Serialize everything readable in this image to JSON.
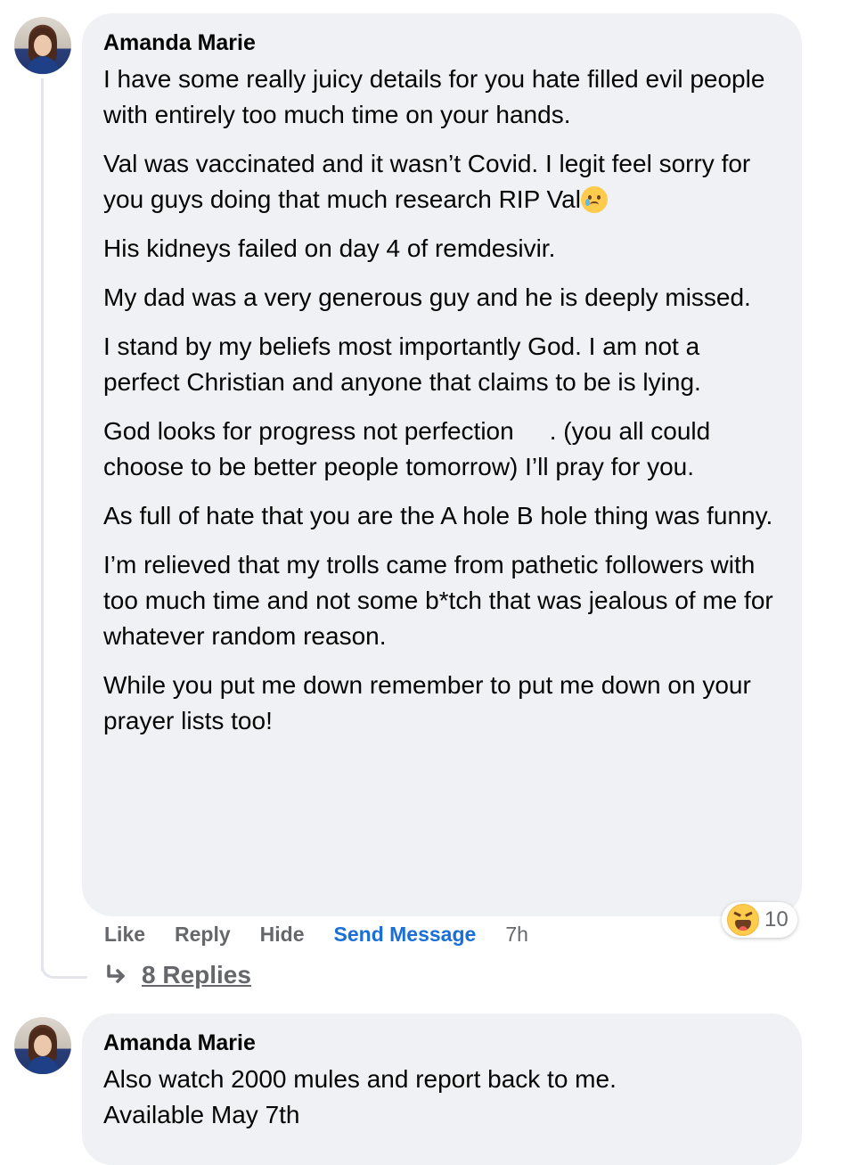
{
  "comments": [
    {
      "author": "Amanda Marie",
      "paragraphs": [
        "I have some really juicy details for you hate filled evil people with entirely too much time on your hands.",
        "Val was vaccinated and it wasn’t Covid. I legit feel sorry for you guys doing that much research RIP Val",
        "His kidneys failed on day 4 of remdesivir.",
        "My dad was a very generous guy and he is deeply missed.",
        "I stand by my beliefs most importantly God. I am not a perfect Christian and anyone that claims to be is lying.",
        "God looks for progress not perfection",
        ". (you all could choose to be better people tomorrow) I’ll pray for you.",
        "As full of hate that you are the A hole B hole thing was funny.",
        "I’m relieved that my trolls came from pathetic followers with too much time and not some b*tch that was jealous of me for whatever random reason.",
        "While you put me down remember to put me down on your prayer lists too!"
      ],
      "actions": {
        "like": "Like",
        "reply": "Reply",
        "hide": "Hide",
        "send_message": "Send Message",
        "time": "7h"
      },
      "reaction": {
        "icon": "haha-emoji-icon",
        "count": "10"
      },
      "replies_label": "8 Replies"
    },
    {
      "author": "Amanda Marie",
      "paragraphs": [
        "Also watch 2000 mules and report back to me. Available May 7th"
      ]
    }
  ],
  "colors": {
    "bubble": "#f0f1f5",
    "link_blue": "#1a6ed8",
    "muted": "#65676b"
  }
}
